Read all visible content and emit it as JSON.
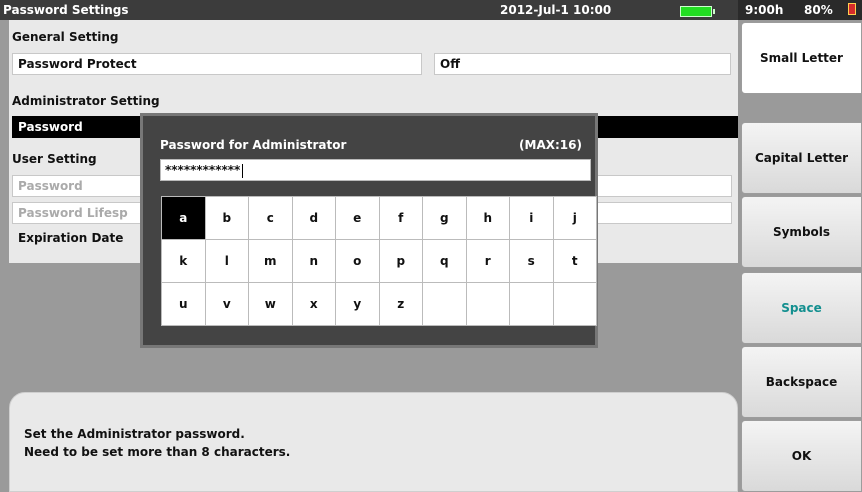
{
  "titlebar": {
    "title": "Password Settings",
    "datetime": "2012-Jul-1 10:00"
  },
  "status": {
    "clock": "9:00h",
    "battery_pct": "80%"
  },
  "settings": {
    "general_label": "General Setting",
    "password_protect_label": "Password Protect",
    "password_protect_value": "Off",
    "admin_label": "Administrator Setting",
    "admin_password_label": "Password",
    "user_label": "User Setting",
    "user_password_label": "Password",
    "lifespan_label": "Password Lifesp",
    "expiration_label": "Expiration Date"
  },
  "dialog": {
    "title": "Password for Administrator",
    "max": "(MAX:16)",
    "password_masked": "************",
    "keys": [
      "a",
      "b",
      "c",
      "d",
      "e",
      "f",
      "g",
      "h",
      "i",
      "j",
      "k",
      "l",
      "m",
      "n",
      "o",
      "p",
      "q",
      "r",
      "s",
      "t",
      "u",
      "v",
      "w",
      "x",
      "y",
      "z",
      "",
      "",
      "",
      ""
    ],
    "selected_key": "a"
  },
  "message": {
    "line1": "Set the Administrator password.",
    "line2": "Need to be set  more than 8 characters."
  },
  "softkeys": [
    "Small Letter",
    "Capital Letter",
    "Symbols",
    "Space",
    "Backspace",
    "OK"
  ],
  "colors": {
    "space_label": "#138f8f",
    "selected_key_bg": "#000000",
    "battery_main": "#22dd22",
    "battery_status": "#d62b2b"
  }
}
